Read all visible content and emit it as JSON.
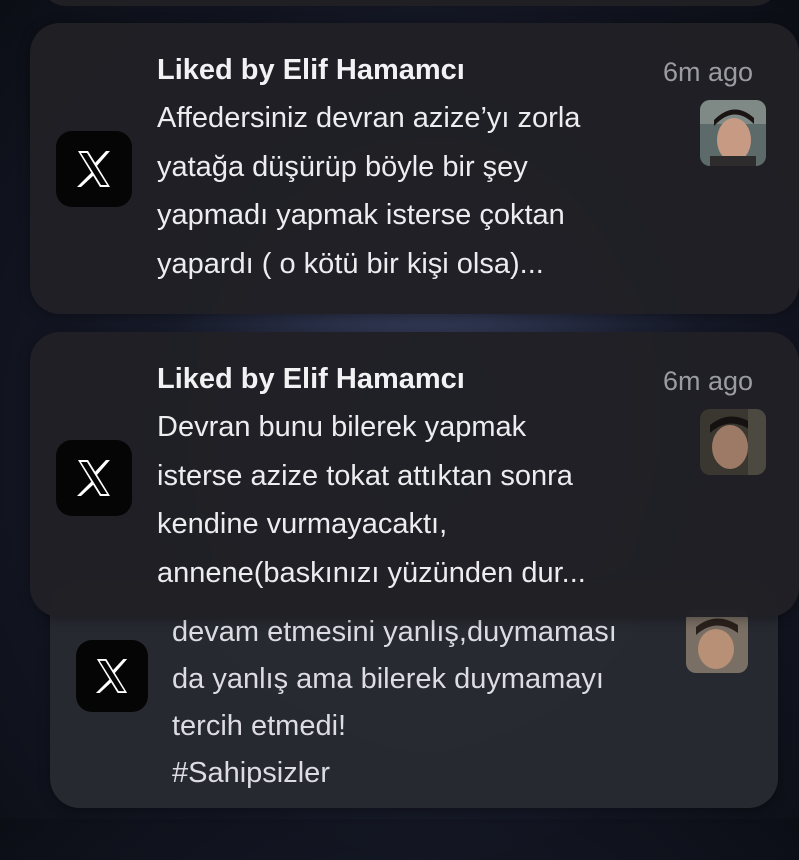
{
  "notifications": [
    {
      "app_icon": "x-logo-icon",
      "title": "Liked by Elif Hamamcı",
      "time": "6m ago",
      "body": "Affedersiniz devran azize’yı zorla\nyatağa düşürüp böyle bir şey\nyapmadı yapmak isterse çoktan\nyapardı ( o kötü bir kişi olsa)...",
      "thumbnail": "avatar-photo"
    },
    {
      "app_icon": "x-logo-icon",
      "title": "Liked by Elif Hamamcı",
      "time": "6m ago",
      "body": "Devran bunu bilerek yapmak\nisterse azize tokat attıktan sonra\nkendine vurmayacaktı,\nannene(baskınızı yüzünden dur...",
      "thumbnail": "avatar-photo"
    },
    {
      "app_icon": "x-logo-icon",
      "body": "devam etmesini yanlış,duymaması\nda yanlış ama bilerek duymamayı\ntercih etmedi!\n#Sahipsizler",
      "thumbnail": "avatar-photo"
    }
  ],
  "colors": {
    "card": "#202025",
    "title": "#f2f2f4",
    "time": "#9b9ba2",
    "app_icon_bg": "#050505"
  }
}
